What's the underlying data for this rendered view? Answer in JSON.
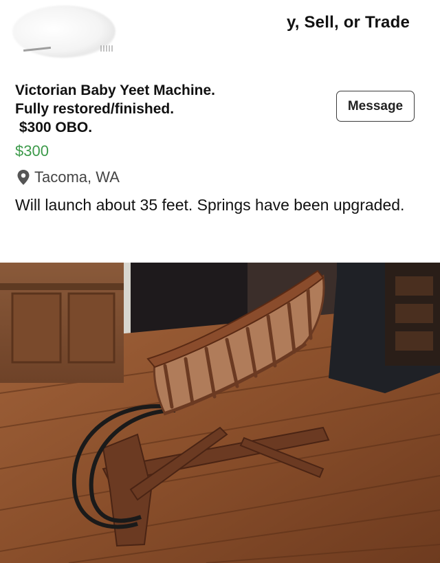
{
  "header": {
    "group_name": "y, Sell, or Trade"
  },
  "listing": {
    "title_lines": [
      "Victorian Baby Yeet Machine.",
      "Fully restored/finished.",
      " $300 OBO."
    ],
    "message_button": "Message",
    "price": "$300",
    "location": "Tacoma, WA",
    "description": "Will launch about 35 feet. Springs have been upgraded."
  },
  "photo": {
    "subject": "wooden-cradle-on-rocking-base"
  },
  "colors": {
    "price": "#3c9a4a",
    "text": "#111111",
    "location": "#444444",
    "button_border": "#3a3a3a"
  },
  "icons": {
    "location": "map-pin-icon"
  }
}
